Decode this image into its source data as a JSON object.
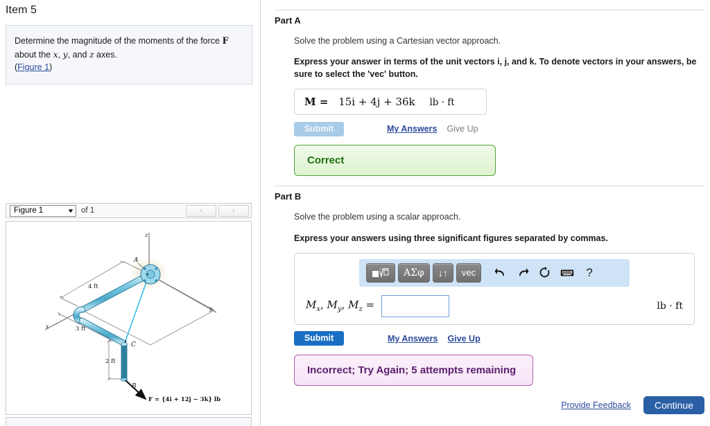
{
  "item": {
    "title": "Item 5",
    "question_line1_pre": "Determine the magnitude of the moments of the force ",
    "question_force_symbol": "F",
    "question_line2_pre": "about the ",
    "question_var_x": "x",
    "question_sep1": ", ",
    "question_var_y": "y",
    "question_sep2": ", and ",
    "question_var_z": "z",
    "question_line2_post": " axes.",
    "figure_link": "Figure 1",
    "paren_open": "(",
    "paren_close": ")"
  },
  "figure_bar": {
    "selected": "Figure 1",
    "caret": "▼",
    "of_label": "of 1",
    "prev": "‹",
    "next": "›"
  },
  "figure": {
    "axis_x": "x",
    "axis_y": "y",
    "axis_z": "z",
    "point_a": "A",
    "point_b": "B",
    "point_c": "C",
    "dim_4ft": "4 ft",
    "dim_3ft": "3 ft",
    "dim_2ft": "2 ft",
    "force_label": "F = {4i + 12j − 3k} lb"
  },
  "part_a": {
    "heading": "Part A",
    "prompt": "Solve the problem using a Cartesian vector approach.",
    "instruction": "Express your answer in terms of the unit vectors i, j, and k. To denote vectors in your answers, be sure to select the 'vec' button.",
    "answer_symbol": "M =",
    "answer_value": "15i + 4j + 36k",
    "answer_unit": "lb · ft",
    "submit_label": "Submit",
    "my_answers_label": "My Answers",
    "give_up_label": "Give Up",
    "feedback": "Correct"
  },
  "part_b": {
    "heading": "Part B",
    "prompt": "Solve the problem using a scalar approach.",
    "instruction": "Express your answers using three significant figures separated by commas.",
    "toolbar": {
      "template_label": "▣√",
      "greek_label": "ΑΣφ",
      "arrows_label": "↓↑",
      "vec_label": "vec",
      "undo_label": "↰",
      "redo_label": "↱",
      "reset_label": "↻",
      "keyboard_label": "⌨",
      "help_label": "?"
    },
    "answer_label_parts": [
      "M",
      "x",
      ", M",
      "y",
      ", M",
      "z",
      " ="
    ],
    "input_value": "",
    "input_placeholder": "",
    "answer_unit": "lb · ft",
    "submit_label": "Submit",
    "my_answers_label": "My Answers",
    "give_up_label": "Give Up",
    "feedback": "Incorrect; Try Again; 5 attempts remaining"
  },
  "footer": {
    "feedback_link": "Provide Feedback",
    "continue_label": "Continue"
  },
  "colors": {
    "link": "#2b4a9b",
    "submit_active": "#1a6fc4",
    "submit_disabled": "#a8cbe8",
    "correct_border": "#53a23a",
    "correct_text": "#1d6f0f",
    "incorrect_border": "#b05fb0",
    "incorrect_text": "#5c1f6e",
    "toolbar_bg": "#cfe3f7",
    "pipe": "#7ec8e3"
  }
}
